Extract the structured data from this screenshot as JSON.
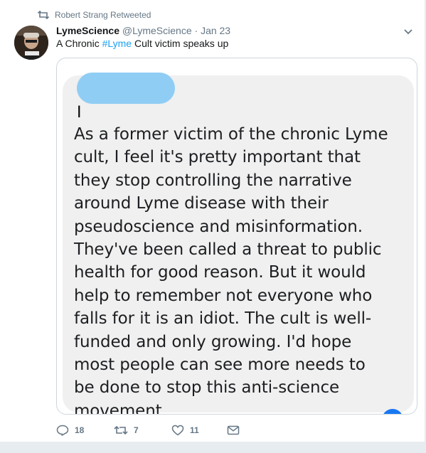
{
  "retweet_context": {
    "icon": "retweet-icon",
    "text": "Robert Strang Retweeted"
  },
  "author": {
    "name": "LymeScience",
    "handle": "@LymeScience",
    "separator": "·",
    "date": "Jan 23",
    "avatar_icon": "avatar-image"
  },
  "tweet": {
    "text_before": "A Chronic ",
    "hashtag": "#Lyme",
    "text_after": " Cult victim speaks up"
  },
  "screenshot_message": {
    "sender_initial": "I",
    "lines": [
      "As a former victim of the chronic Lyme",
      "cult, I feel it's pretty important that",
      "they stop controlling the narrative",
      "around Lyme disease with their",
      "pseudoscience and misinformation.",
      "They've been called a threat to public",
      "health for good reason. But it would",
      "help to remember not everyone who",
      "falls for it is an idiot. The cult is well-",
      "funded and only growing. I'd hope",
      "most people can see more needs to",
      "be done to stop this anti-science",
      "movement."
    ]
  },
  "actions": {
    "reply": {
      "icon": "reply-icon",
      "count": "18"
    },
    "retweet": {
      "icon": "retweet-icon",
      "count": "7"
    },
    "like": {
      "icon": "heart-icon",
      "count": "11"
    },
    "dm": {
      "icon": "envelope-icon"
    }
  },
  "colors": {
    "link": "#1da1f2",
    "muted": "#657786",
    "redaction": "#90cdf4",
    "bubble": "#f0f0f0"
  }
}
